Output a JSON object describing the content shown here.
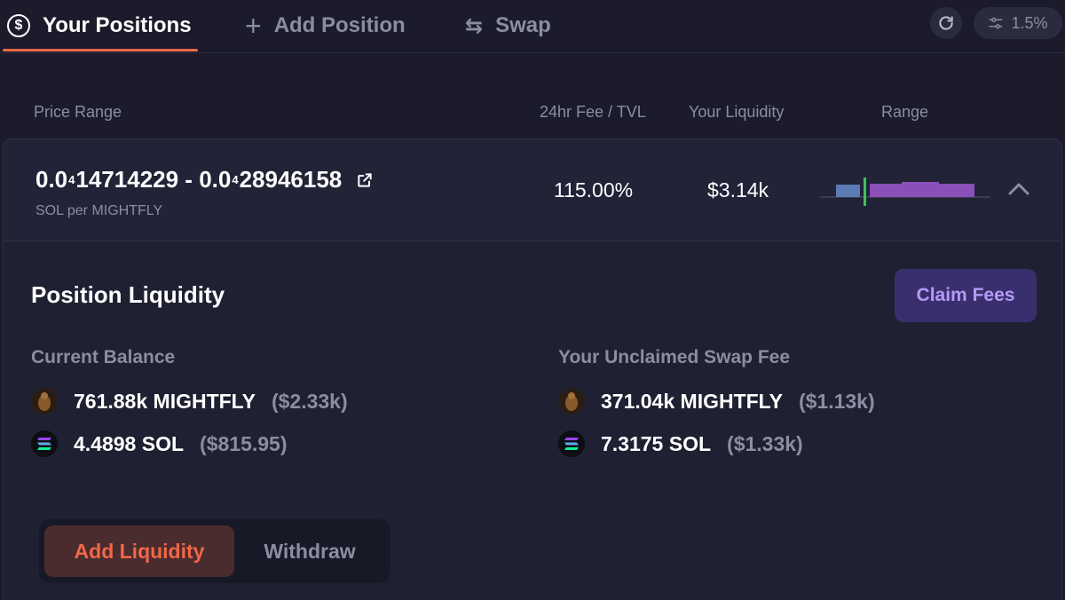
{
  "nav": {
    "tabs": [
      {
        "label": "Your Positions",
        "icon": "dollar-circle-icon",
        "active": true
      },
      {
        "label": "Add Position",
        "icon": "plus-icon",
        "active": false
      },
      {
        "label": "Swap",
        "icon": "swap-arrows-icon",
        "active": false
      }
    ],
    "slippage": "1.5%"
  },
  "table_headers": {
    "price_range": "Price Range",
    "fee_tvl": "24hr Fee / TVL",
    "liquidity": "Your Liquidity",
    "range": "Range"
  },
  "position": {
    "range_low_prefix": "0.0",
    "range_low_zeros": "4",
    "range_low_digits": "14714229",
    "separator": " - ",
    "range_high_prefix": "0.0",
    "range_high_zeros": "4",
    "range_high_digits": "28946158",
    "unit": "SOL per MIGHTFLY",
    "fee_tvl": "115.00%",
    "liquidity": "$3.14k"
  },
  "detail": {
    "title": "Position Liquidity",
    "claim_label": "Claim Fees",
    "balance_title": "Current Balance",
    "fee_title": "Your Unclaimed Swap Fee",
    "balance": [
      {
        "amount": "761.88k MIGHTFLY",
        "usd": "($2.33k)",
        "icon": "mightfly-token-icon"
      },
      {
        "amount": "4.4898 SOL",
        "usd": "($815.95)",
        "icon": "sol-token-icon"
      }
    ],
    "fees": [
      {
        "amount": "371.04k MIGHTFLY",
        "usd": "($1.13k)",
        "icon": "mightfly-token-icon"
      },
      {
        "amount": "7.3175 SOL",
        "usd": "($1.33k)",
        "icon": "sol-token-icon"
      }
    ]
  },
  "actions": {
    "add_liquidity": "Add Liquidity",
    "withdraw": "Withdraw"
  },
  "colors": {
    "accent": "#f0674a",
    "purple": "#b59af5",
    "muted": "#8b8ea0",
    "range_sol": "#5c7bb5",
    "range_token": "#8b4fb8",
    "current_price": "#3fc15a"
  }
}
